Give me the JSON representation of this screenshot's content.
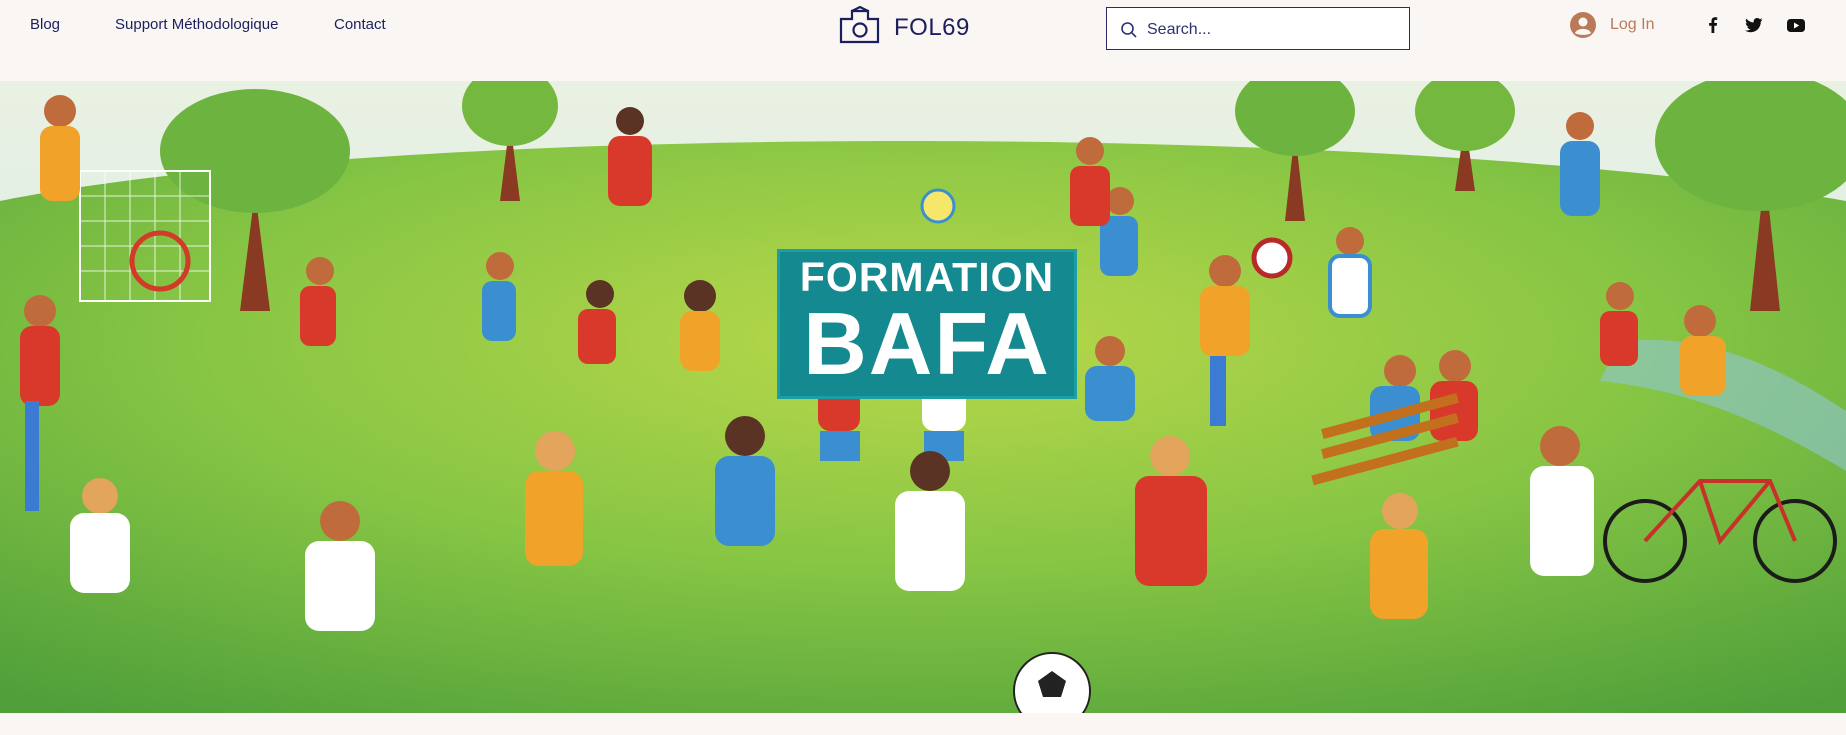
{
  "nav": {
    "items": [
      {
        "label": "Blog"
      },
      {
        "label": "Support Méthodologique"
      },
      {
        "label": "Contact"
      }
    ]
  },
  "brand": {
    "name": "FOL69",
    "icon": "camera-icon"
  },
  "search": {
    "placeholder": "Search..."
  },
  "auth": {
    "login_label": "Log In",
    "icon": "user-avatar-icon"
  },
  "social": [
    {
      "icon": "facebook-icon"
    },
    {
      "icon": "twitter-icon"
    },
    {
      "icon": "youtube-icon"
    }
  ],
  "hero": {
    "title_line1": "FORMATION",
    "title_line2": "BAFA"
  },
  "colors": {
    "nav_text": "#1c1f5e",
    "login_text": "#b97a5a",
    "page_bg": "#faf6f3",
    "banner_bg": "#14898f",
    "grass": "#7cc043",
    "sky": "#cfe8ef"
  }
}
